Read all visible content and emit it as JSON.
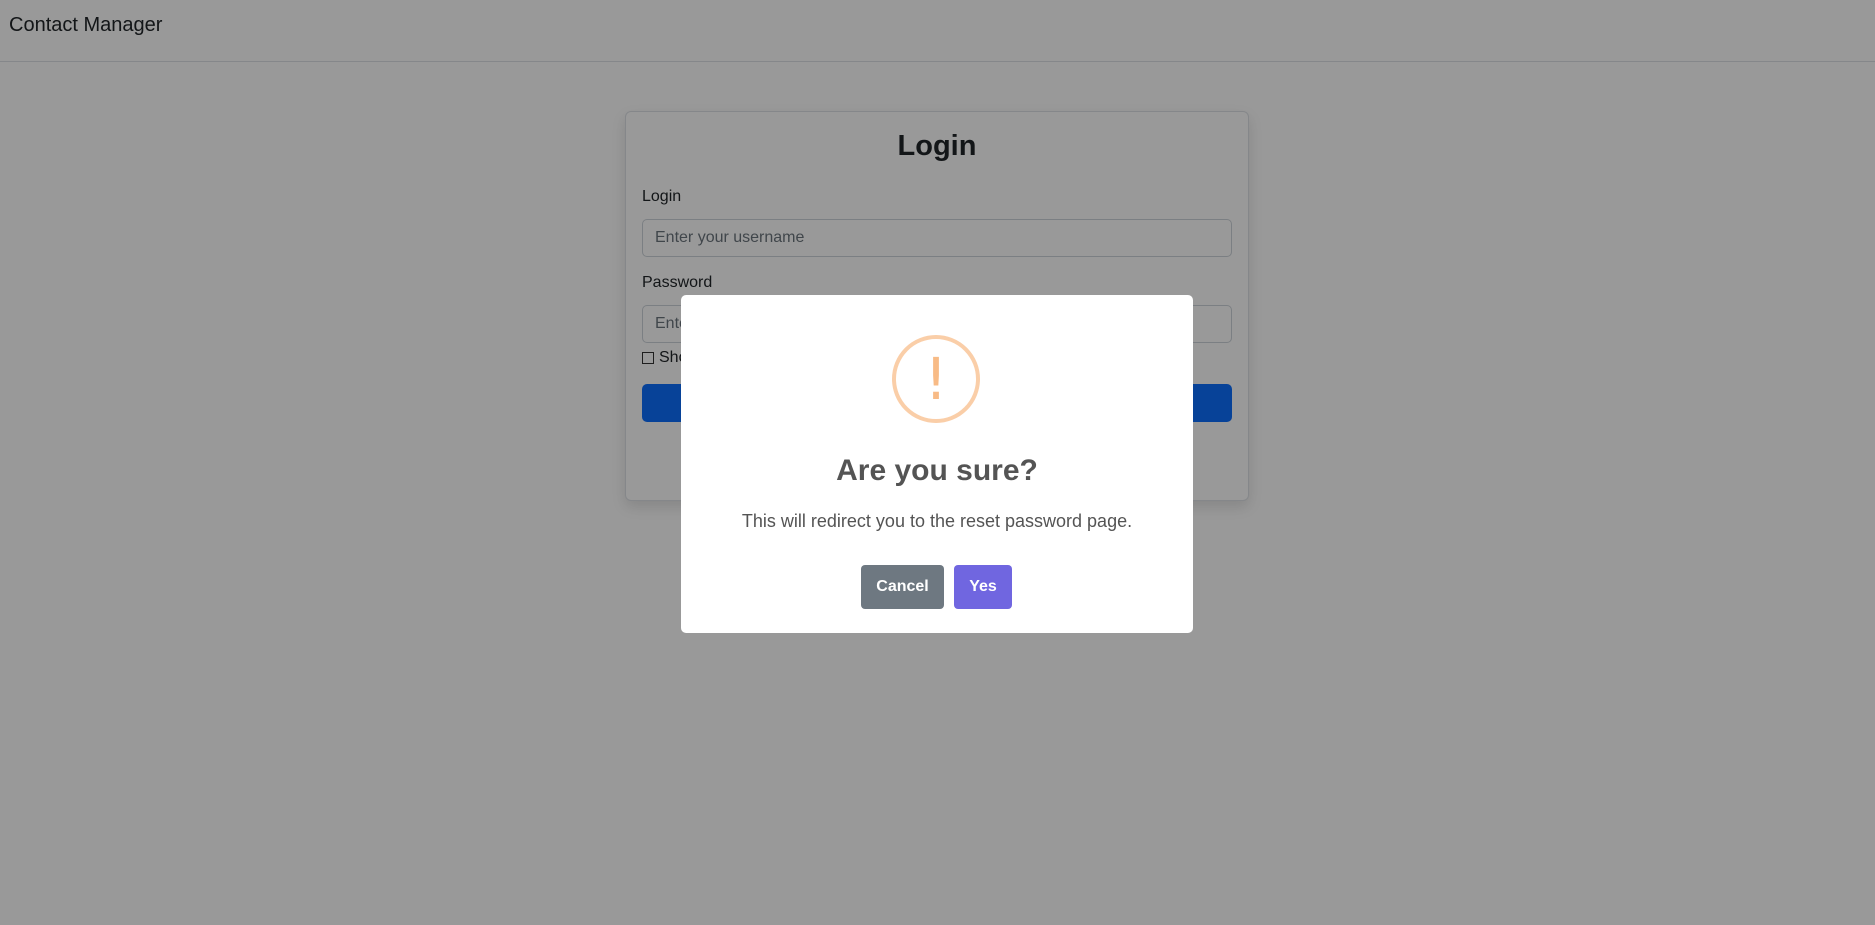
{
  "navbar": {
    "brand": "Contact Manager"
  },
  "login_card": {
    "title": "Login",
    "login_label": "Login",
    "username_placeholder": "Enter your username",
    "password_label": "Password",
    "password_placeholder": "Enter your password",
    "show_password_label": "Show password"
  },
  "dialog": {
    "icon": "exclamation-icon",
    "icon_glyph": "!",
    "icon_color": "#f8bb86",
    "title": "Are you sure?",
    "text": "This will redirect you to the reset password page.",
    "cancel_label": "Cancel",
    "confirm_label": "Yes",
    "cancel_color": "#6e7881",
    "confirm_color": "#7066e0"
  }
}
